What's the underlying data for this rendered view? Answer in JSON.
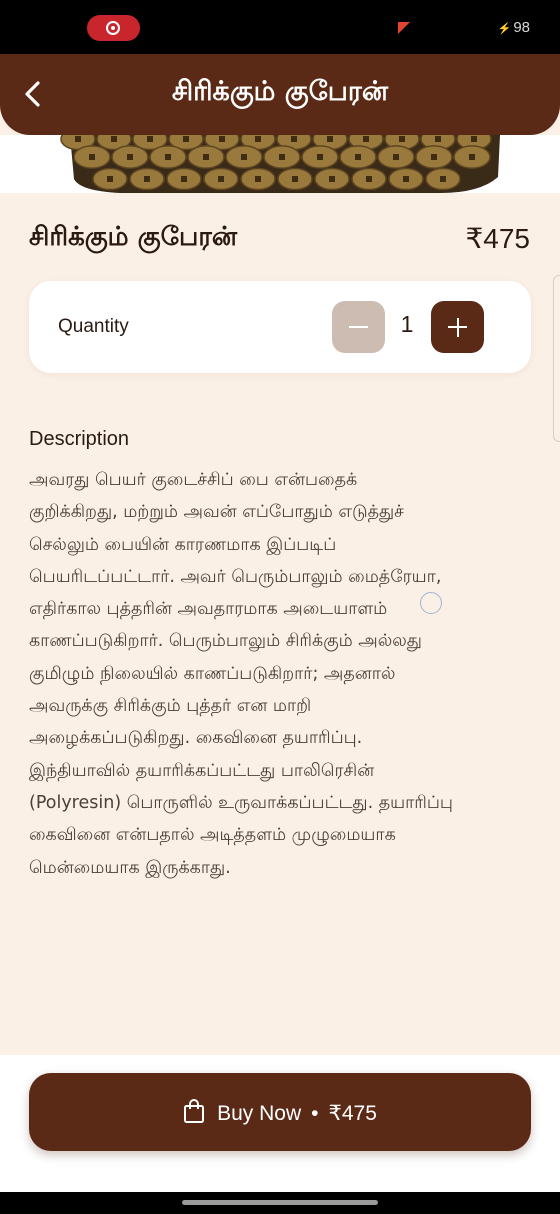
{
  "status_bar": {
    "recording_icon": "screen-record-icon",
    "battery_level": "98"
  },
  "header": {
    "title": "சிரிக்கும் குபேரன்",
    "back_icon": "chevron-left-icon"
  },
  "product": {
    "name": "சிரிக்கும் குபேரன்",
    "price": "₹475",
    "image_alt": "brass coins"
  },
  "quantity": {
    "label": "Quantity",
    "value": "1",
    "decrement_icon": "minus-icon",
    "increment_icon": "plus-icon"
  },
  "description": {
    "heading": "Description",
    "lines": [
      "அவரது பெயர் குடைச்சிப் பை என்பதைக்",
      "குறிக்கிறது, மற்றும் அவன் எப்போதும் எடுத்துச்",
      "செல்லும் பையின் காரணமாக இப்படிப்",
      "பெயரிடப்பட்டார். அவர் பெரும்பாலும் மைத்ரேயா,",
      "எதிர்கால புத்தரின் அவதாரமாக அடையாளம்",
      "காணப்படுகிறார். பெரும்பாலும் சிரிக்கும் அல்லது",
      "குமிழும் நிலையில் காணப்படுகிறார்; அதனால்",
      "அவருக்கு சிரிக்கும் புத்தர் என மாறி",
      "அழைக்கப்படுகிறது. கைவினை தயாரிப்பு.",
      "இந்தியாவில் தயாரிக்கப்பட்டது பாலிரெசின்",
      "(Polyresin) பொருளில் உருவாக்கப்பட்டது. தயாரிப்பு",
      "கைவினை என்பதால் அடித்தளம் முழுமையாக",
      "மென்மையாக இருக்காது."
    ]
  },
  "buy_button": {
    "icon": "shopping-bag-icon",
    "label": "Buy Now",
    "separator": "•",
    "price": "₹475"
  },
  "colors": {
    "brand": "#5a2a16",
    "background": "#fbf0e6",
    "card": "#ffffff",
    "disabled_button": "#cdbcb1"
  }
}
